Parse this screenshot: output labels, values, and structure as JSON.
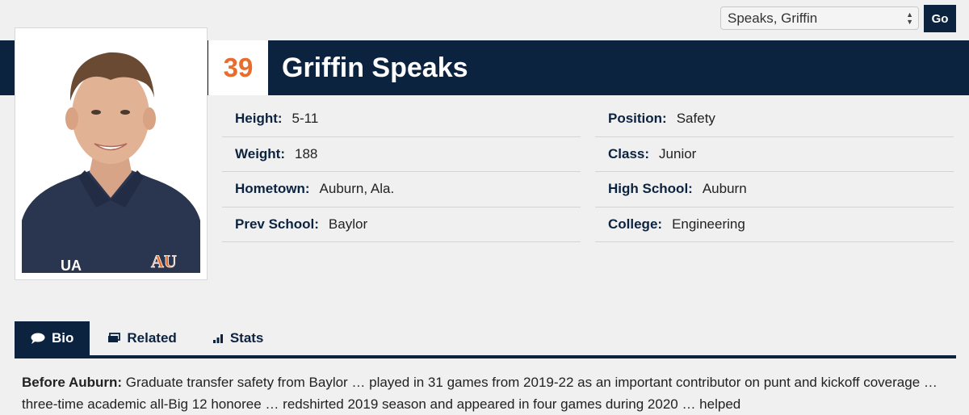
{
  "player_select": {
    "value": "Speaks, Griffin",
    "go_label": "Go"
  },
  "player": {
    "number": "39",
    "name": "Griffin Speaks"
  },
  "info_left": [
    {
      "label": "Height:",
      "value": "5-11"
    },
    {
      "label": "Weight:",
      "value": "188"
    },
    {
      "label": "Hometown:",
      "value": "Auburn, Ala."
    },
    {
      "label": "Prev School:",
      "value": "Baylor"
    }
  ],
  "info_right": [
    {
      "label": "Position:",
      "value": "Safety"
    },
    {
      "label": "Class:",
      "value": "Junior"
    },
    {
      "label": "High School:",
      "value": "Auburn"
    },
    {
      "label": "College:",
      "value": "Engineering"
    }
  ],
  "tabs": [
    {
      "label": "Bio",
      "icon": "speech-bubble-icon",
      "active": true
    },
    {
      "label": "Related",
      "icon": "cards-icon",
      "active": false
    },
    {
      "label": "Stats",
      "icon": "bar-chart-icon",
      "active": false
    }
  ],
  "bio": {
    "heading": "Before Auburn:",
    "text": "Graduate transfer safety from Baylor … played in 31 games from 2019-22 as an important contributor on punt and kickoff coverage … three-time academic all-Big 12 honoree … redshirted 2019 season and appeared in four games during 2020 … helped"
  },
  "colors": {
    "navy": "#0c2340",
    "orange": "#e86d2c",
    "background": "#f0f0f0"
  }
}
